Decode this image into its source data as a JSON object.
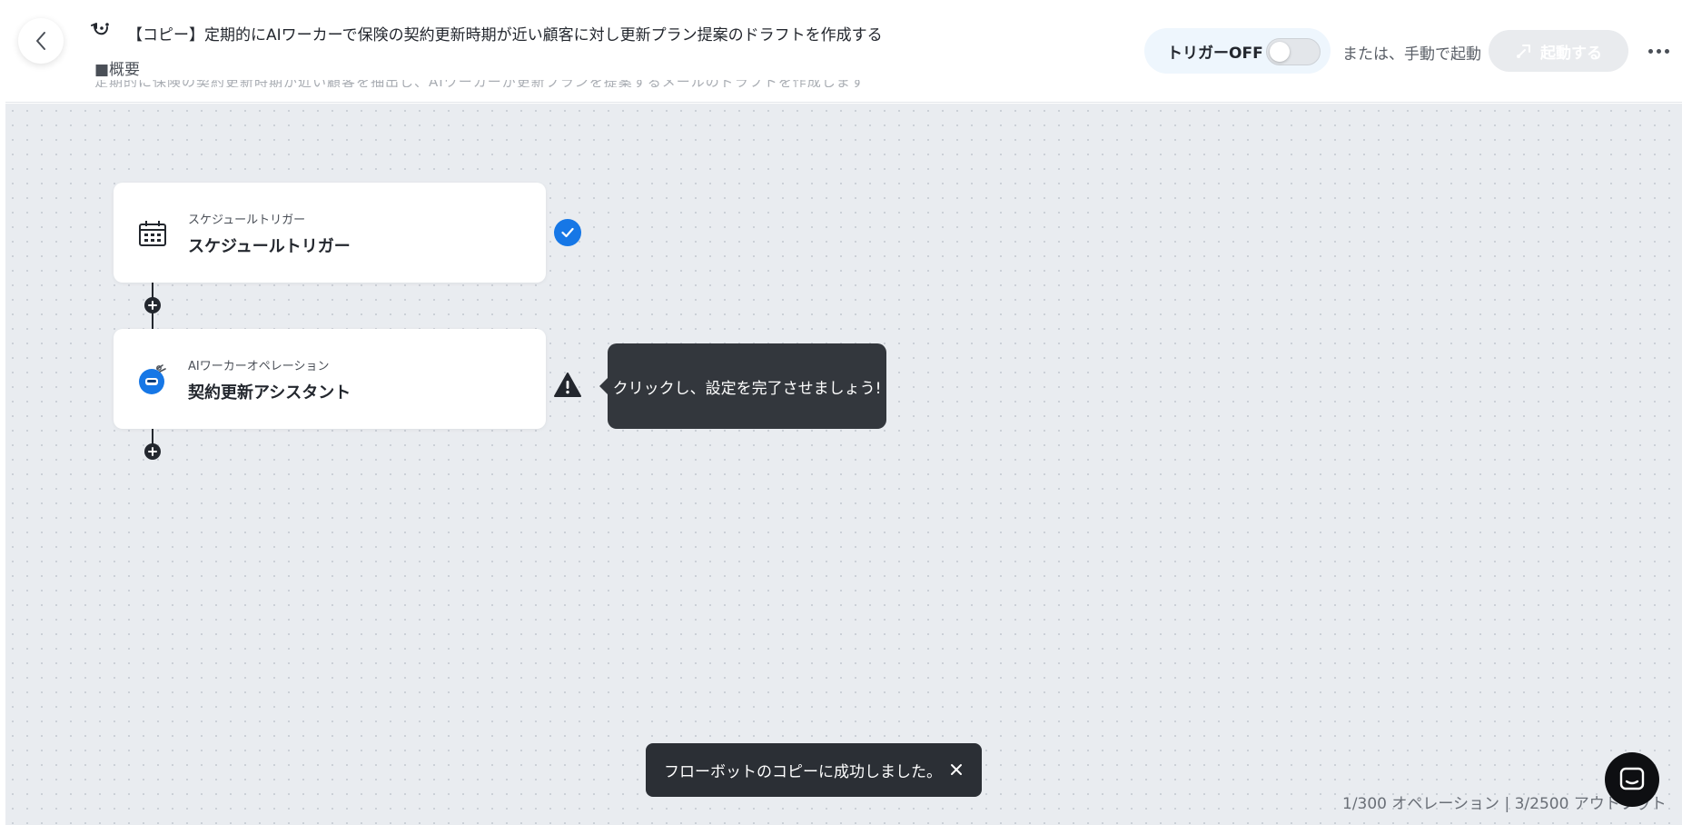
{
  "header": {
    "title": "【コピー】定期的にAIワーカーで保険の契約更新時期が近い顧客に対し更新プラン提案のドラフトを作成する",
    "overview_label": "■概要",
    "overview_faded": "定期的に保険の契約更新時期が近い顧客を抽出し、AIワーカーが更新プランを提案するメールのドラフトを作成します",
    "trigger_label": "トリガーOFF",
    "trigger_on": false,
    "manual_label": "または、手動で起動",
    "start_label": "起動する"
  },
  "flow": {
    "nodes": [
      {
        "subtitle": "スケジュールトリガー",
        "name": "スケジュールトリガー",
        "icon": "calendar-schedule-icon",
        "status": "complete"
      },
      {
        "subtitle": "AIワーカーオペレーション",
        "name": "契約更新アシスタント",
        "icon": "ai-worker-icon",
        "status": "warning"
      }
    ],
    "tooltip": "クリックし、設定を完了させましょう!"
  },
  "toast": {
    "message": "フローボットのコピーに成功しました。"
  },
  "usage": {
    "text": "1/300 オペレーション | 3/2500 アウトプット"
  },
  "colors": {
    "accent": "#1677e6",
    "canvas": "#e9ecf0",
    "tooltip": "#33373d",
    "toast": "#2b2f35"
  }
}
